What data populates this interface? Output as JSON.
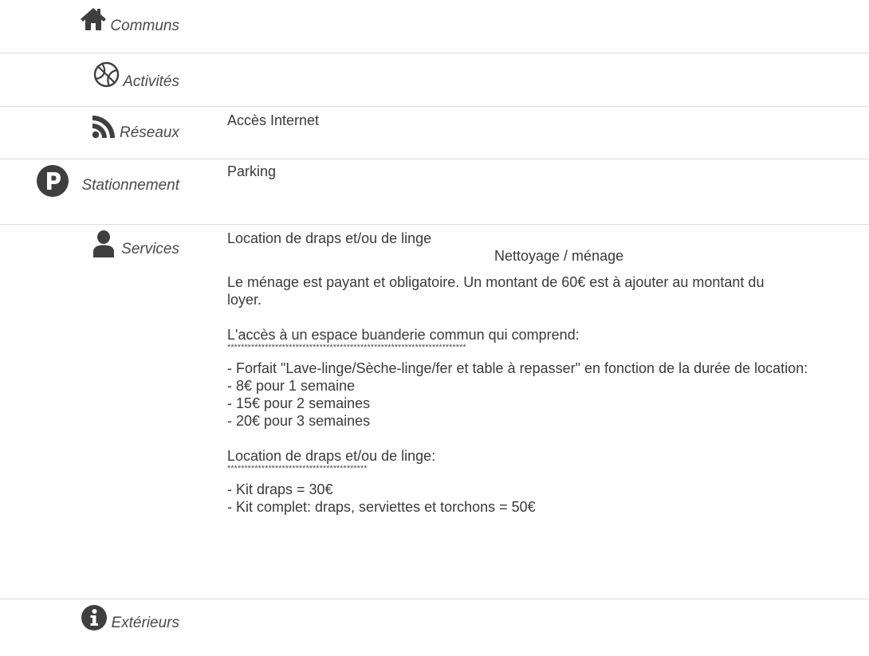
{
  "sections": {
    "communs": {
      "label": "Communs",
      "icon": "home-icon"
    },
    "activites": {
      "label": "Activités",
      "icon": "dribbble-ball-icon"
    },
    "reseaux": {
      "label": "Réseaux",
      "icon": "rss-icon",
      "items": [
        "Accès Internet"
      ]
    },
    "stationnement": {
      "label": "Stationnement",
      "icon": "parking-icon",
      "items": [
        "Parking"
      ]
    },
    "services": {
      "label": "Services",
      "icon": "user-icon",
      "items": [
        "Location de draps et/ou de linge",
        "Nettoyage / ménage"
      ],
      "description": {
        "menage": "Le ménage est payant et obligatoire. Un montant de 60€ est à ajouter au montant du loyer.",
        "buanderie_title": "L'accès à un espace buanderie commun qui comprend:",
        "buanderie_stars": "**********************************************************************",
        "forfait": "- Forfait \"Lave-linge/Sèche-linge/fer et table à repasser\" en fonction de la durée de location:",
        "forfait_lines": [
          "- 8€ pour 1 semaine",
          "- 15€ pour 2 semaines",
          "- 20€ pour 3 semaines"
        ],
        "linge_title": "Location de draps et/ou de linge:",
        "linge_stars": "*****************************************",
        "linge_lines": [
          "- Kit draps = 30€",
          "- Kit complet: draps, serviettes et torchons = 50€"
        ]
      }
    },
    "exterieurs": {
      "label": "Extérieurs",
      "icon": "info-icon"
    }
  }
}
